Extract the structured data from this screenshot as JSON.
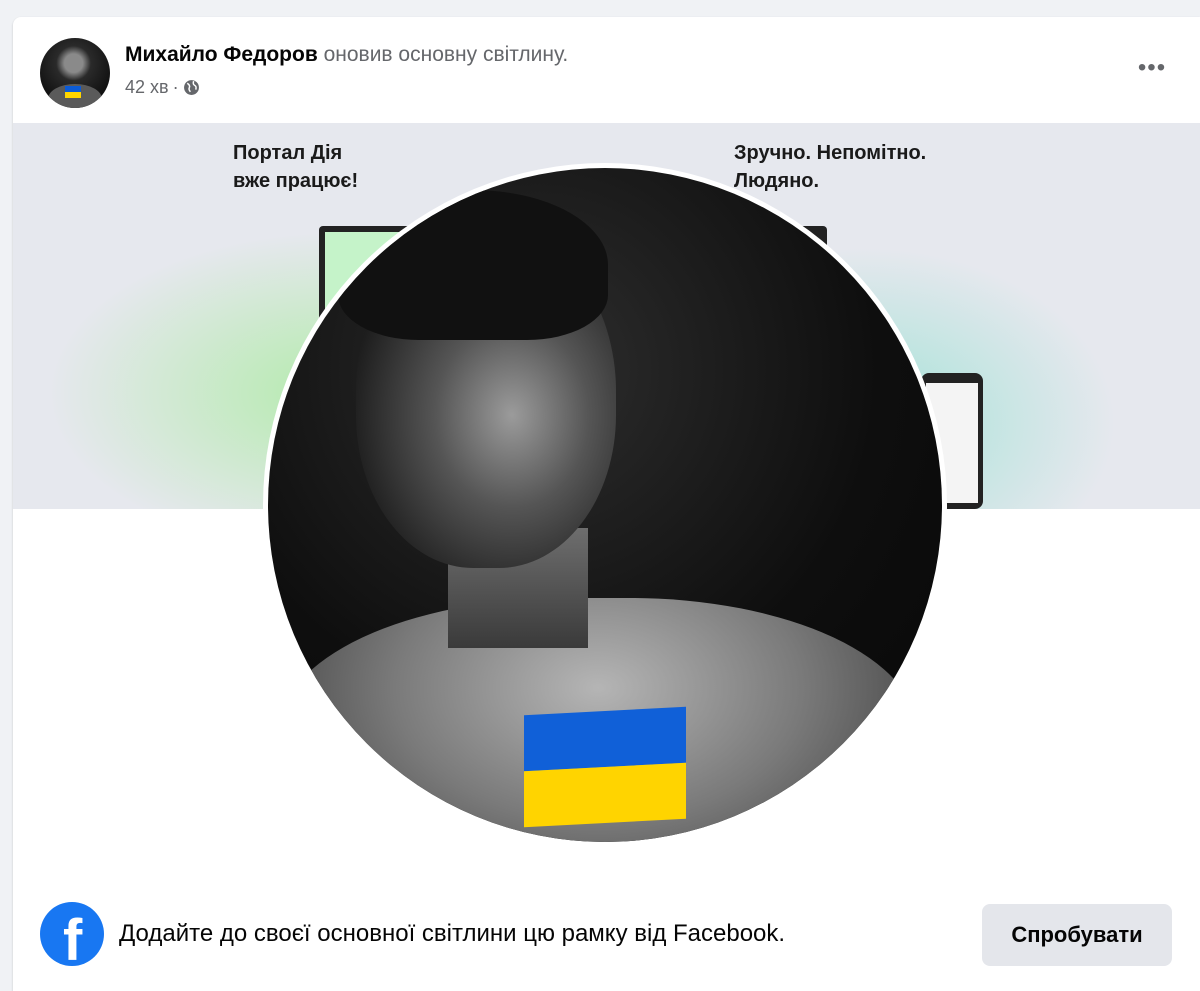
{
  "post": {
    "author": "Михайло Федоров",
    "action": "оновив основну світлину.",
    "time": "42 хв",
    "separator": "·",
    "audience_icon": "globe-icon",
    "more_label": "•••"
  },
  "cover": {
    "left_text": "Портал Дія\nвже працює!",
    "right_text": "Зручно. Непомітно.\nЛюдяно."
  },
  "frame_prompt": {
    "logo_letter": "f",
    "text": "Додайте до своєї основної світлини цю рамку від Facebook.",
    "button_label": "Спробувати"
  },
  "colors": {
    "flag_blue": "#1060d8",
    "flag_yellow": "#ffd400",
    "facebook_blue": "#1877f2"
  }
}
